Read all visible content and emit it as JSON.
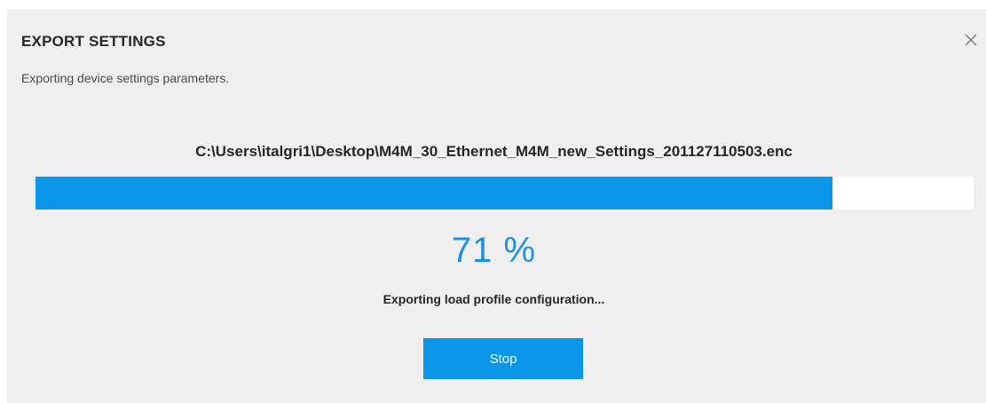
{
  "dialog": {
    "title": "EXPORT SETTINGS",
    "subtitle": "Exporting device settings parameters.",
    "close_icon": "close-icon"
  },
  "export": {
    "file_path": "C:\\Users\\italgri1\\Desktop\\M4M_30_Ethernet_M4M_new_Settings_201127110503.enc",
    "progress_percent": 85,
    "percent_label": "71 %",
    "status_text": "Exporting load profile configuration..."
  },
  "actions": {
    "stop_label": "Stop"
  },
  "colors": {
    "accent": "#0a96e8",
    "percent_text": "#1f8fe0",
    "dialog_bg": "#efefef"
  }
}
